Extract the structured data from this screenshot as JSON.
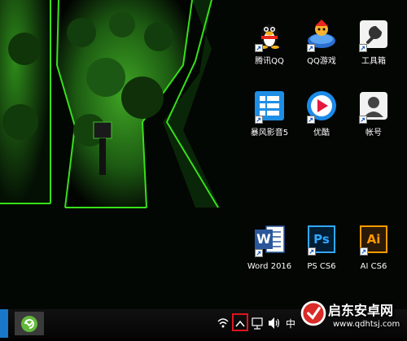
{
  "desktop": {
    "icons": [
      {
        "id": "qq",
        "label": "腾讯QQ",
        "icon": "qq-penguin-icon"
      },
      {
        "id": "qqgame",
        "label": "QQ游戏",
        "icon": "qq-game-icon"
      },
      {
        "id": "toolbox",
        "label": "工具箱",
        "icon": "wrench-icon"
      },
      {
        "id": "baofeng",
        "label": "暴风影音5",
        "icon": "baofeng-player-icon"
      },
      {
        "id": "youku",
        "label": "优酷",
        "icon": "youku-play-icon"
      },
      {
        "id": "account",
        "label": "帐号",
        "icon": "user-silhouette-icon"
      },
      {
        "id": "word",
        "label": "Word 2016",
        "icon": "word-icon",
        "letter": "W"
      },
      {
        "id": "ps",
        "label": "PS CS6",
        "icon": "photoshop-icon",
        "letter": "Ps"
      },
      {
        "id": "ai",
        "label": "AI CS6",
        "icon": "illustrator-icon",
        "letter": "Ai"
      }
    ]
  },
  "taskbar": {
    "tray": {
      "ime_label": "中",
      "highlight_color": "#e0141e"
    }
  },
  "watermark": {
    "title": "启东安卓网",
    "url": "www.qdhtsj.com"
  },
  "colors": {
    "accent_green": "#37e01a",
    "taskbar_blue": "#1a78c8"
  }
}
